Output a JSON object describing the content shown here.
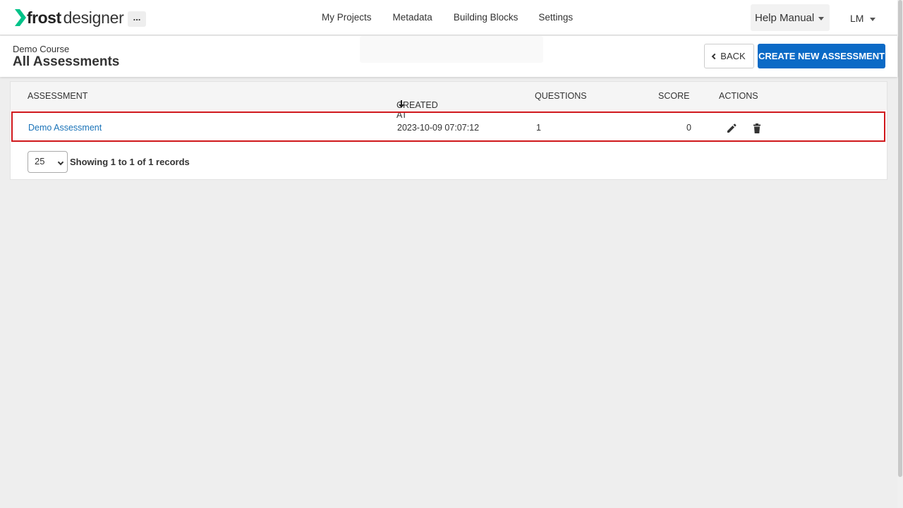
{
  "app": {
    "logo_bold": "frost",
    "logo_light": "designer",
    "more_label": "...",
    "accent": "#0b6ac6",
    "logo_color": "#00c389"
  },
  "nav": {
    "links": [
      "My Projects",
      "Metadata",
      "Building Blocks",
      "Settings"
    ],
    "help_label": "Help Manual",
    "user_label": "LM"
  },
  "header": {
    "course": "Demo Course",
    "title": "All Assessments",
    "back_label": "BACK",
    "create_label": "CREATE NEW ASSESSMENT"
  },
  "table": {
    "columns": {
      "assessment": "ASSESSMENT",
      "created_at": "CREATED AT",
      "questions": "QUESTIONS",
      "score": "SCORE",
      "actions": "ACTIONS"
    },
    "rows": [
      {
        "assessment": "Demo Assessment",
        "created_at": "2023-10-09 07:07:12",
        "questions": "1",
        "score": "0"
      }
    ],
    "highlight_color": "#d0181c"
  },
  "pager": {
    "page_size": "25",
    "records_text": "Showing 1 to 1 of 1 records"
  }
}
